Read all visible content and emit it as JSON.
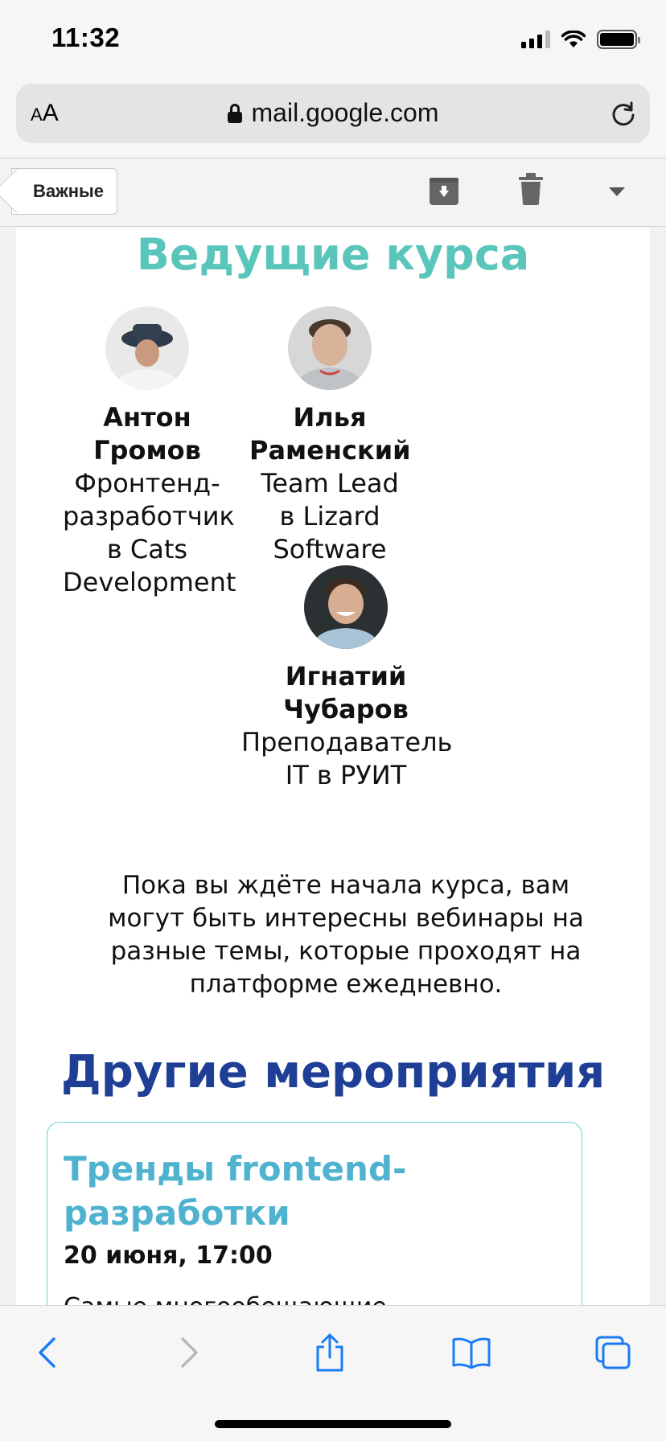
{
  "status": {
    "time": "11:32"
  },
  "browser": {
    "text_size_label": "AA",
    "url": "mail.google.com"
  },
  "mail_toolbar": {
    "back_label": "Важные"
  },
  "email": {
    "hosts_title": "Ведущие курса",
    "hosts": [
      {
        "name": "Антон Громов",
        "role": "Фронтенд-разработчик в Cats Development"
      },
      {
        "name": "Илья Раменский",
        "role": "Team Lead в Lizard Software"
      },
      {
        "name": "Игнатий Чубаров",
        "role": "Преподаватель IT в РУИТ"
      }
    ],
    "intro": "Пока вы ждёте начала курса, вам могут быть интересны вебинары на разные темы, которые проходят на платформе ежедневно.",
    "other_title": "Другие мероприятия",
    "events": [
      {
        "title": "Тренды frontend-разработки",
        "date": "20 июня, 17:00",
        "description": "Самые многообещающие"
      }
    ]
  },
  "colors": {
    "hosts_title": "#5ac6bb",
    "other_title": "#1e3f95",
    "event_title": "#4fb2cf",
    "card_border": "#6ccfd3",
    "ios_blue": "#1a7cf5"
  },
  "icons": [
    "signal-icon",
    "wifi-icon",
    "battery-icon",
    "lock-icon",
    "reload-icon",
    "archive-icon",
    "trash-icon",
    "dropdown-icon",
    "back-icon",
    "forward-icon",
    "share-icon",
    "bookmarks-icon",
    "tabs-icon"
  ]
}
